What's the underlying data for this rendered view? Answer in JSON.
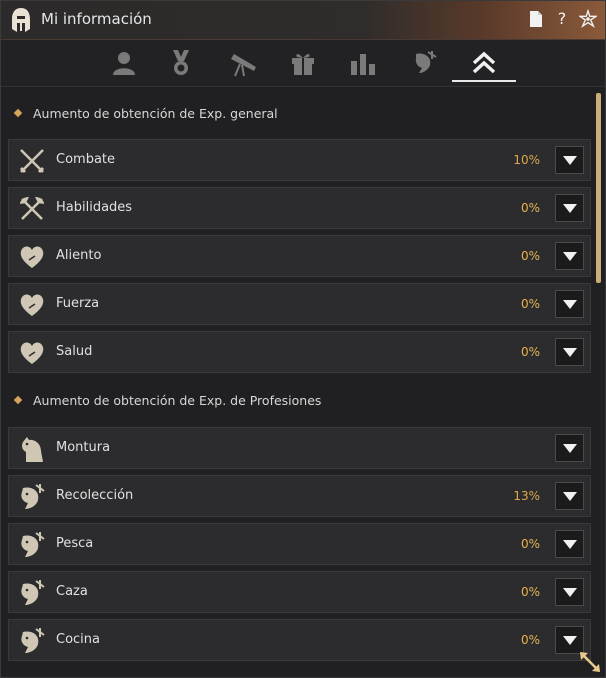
{
  "window": {
    "title": "Mi información"
  },
  "tabs": [
    {
      "icon": "character-icon"
    },
    {
      "icon": "medal-icon"
    },
    {
      "icon": "telescope-icon"
    },
    {
      "icon": "gift-icon"
    },
    {
      "icon": "stats-icon"
    },
    {
      "icon": "lifeskill-icon"
    },
    {
      "icon": "rank-up-icon",
      "active": true
    }
  ],
  "sections": [
    {
      "title": "Aumento de obtención de Exp. general",
      "rows": [
        {
          "icon": "crossed-swords-icon",
          "label": "Combate",
          "value": "10%"
        },
        {
          "icon": "crossed-axes-icon",
          "label": "Habilidades",
          "value": "0%"
        },
        {
          "icon": "heart-icon",
          "label": "Aliento",
          "value": "0%"
        },
        {
          "icon": "heart-icon",
          "label": "Fuerza",
          "value": "0%"
        },
        {
          "icon": "heart-icon",
          "label": "Salud",
          "value": "0%"
        }
      ]
    },
    {
      "title": "Aumento de obtención de Exp. de Profesiones",
      "rows": [
        {
          "icon": "horse-icon",
          "label": "Montura",
          "value": ""
        },
        {
          "icon": "lifeskill-fish-icon",
          "label": "Recolección",
          "value": "13%"
        },
        {
          "icon": "lifeskill-fish-icon",
          "label": "Pesca",
          "value": "0%"
        },
        {
          "icon": "lifeskill-fish-icon",
          "label": "Caza",
          "value": "0%"
        },
        {
          "icon": "lifeskill-fish-icon",
          "label": "Cocina",
          "value": "0%"
        }
      ]
    }
  ],
  "colors": {
    "accent": "#e0a64a",
    "row_bg": "#2c2c2f",
    "scroll": "#c9ad7a"
  }
}
